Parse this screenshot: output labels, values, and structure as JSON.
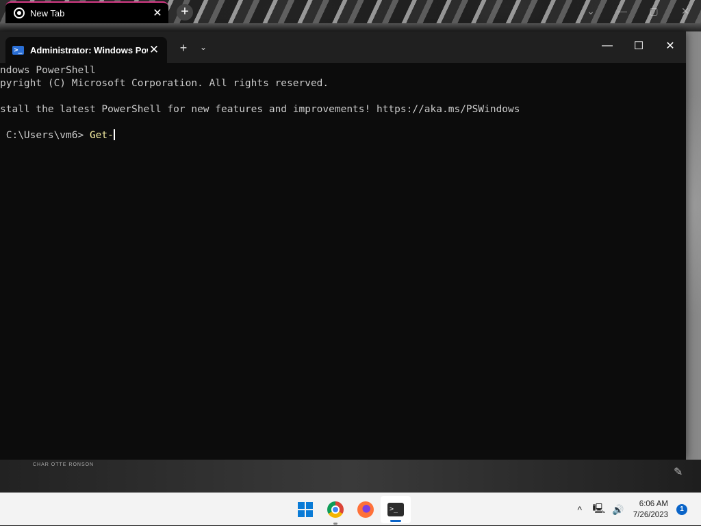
{
  "browser": {
    "tab_title": "New Tab",
    "tab_close": "✕",
    "new_tab": "+",
    "controls": [
      "⌄",
      "—",
      "▢",
      "✕"
    ]
  },
  "terminal": {
    "tab_title": "Administrator: Windows PowerShell",
    "tab_close": "✕",
    "new_tab": "+",
    "dropdown": "⌄",
    "minimize": "—",
    "maximize": "☐",
    "close": "✕",
    "lines": [
      "ndows PowerShell",
      "pyright (C) Microsoft Corporation. All rights reserved.",
      "",
      "stall the latest PowerShell for new features and improvements! https://aka.ms/PSWindows",
      ""
    ],
    "prompt": " C:\\Users\\vm6> ",
    "command": "Get-"
  },
  "background": {
    "caption": "CHAR OTTE RONSON"
  },
  "taskbar": {
    "apps": [
      "start",
      "chrome",
      "firefox",
      "terminal"
    ],
    "time": "6:06 AM",
    "date": "7/26/2023",
    "notification_count": "1",
    "chevron": "^",
    "accent": "#0a7bd6"
  }
}
